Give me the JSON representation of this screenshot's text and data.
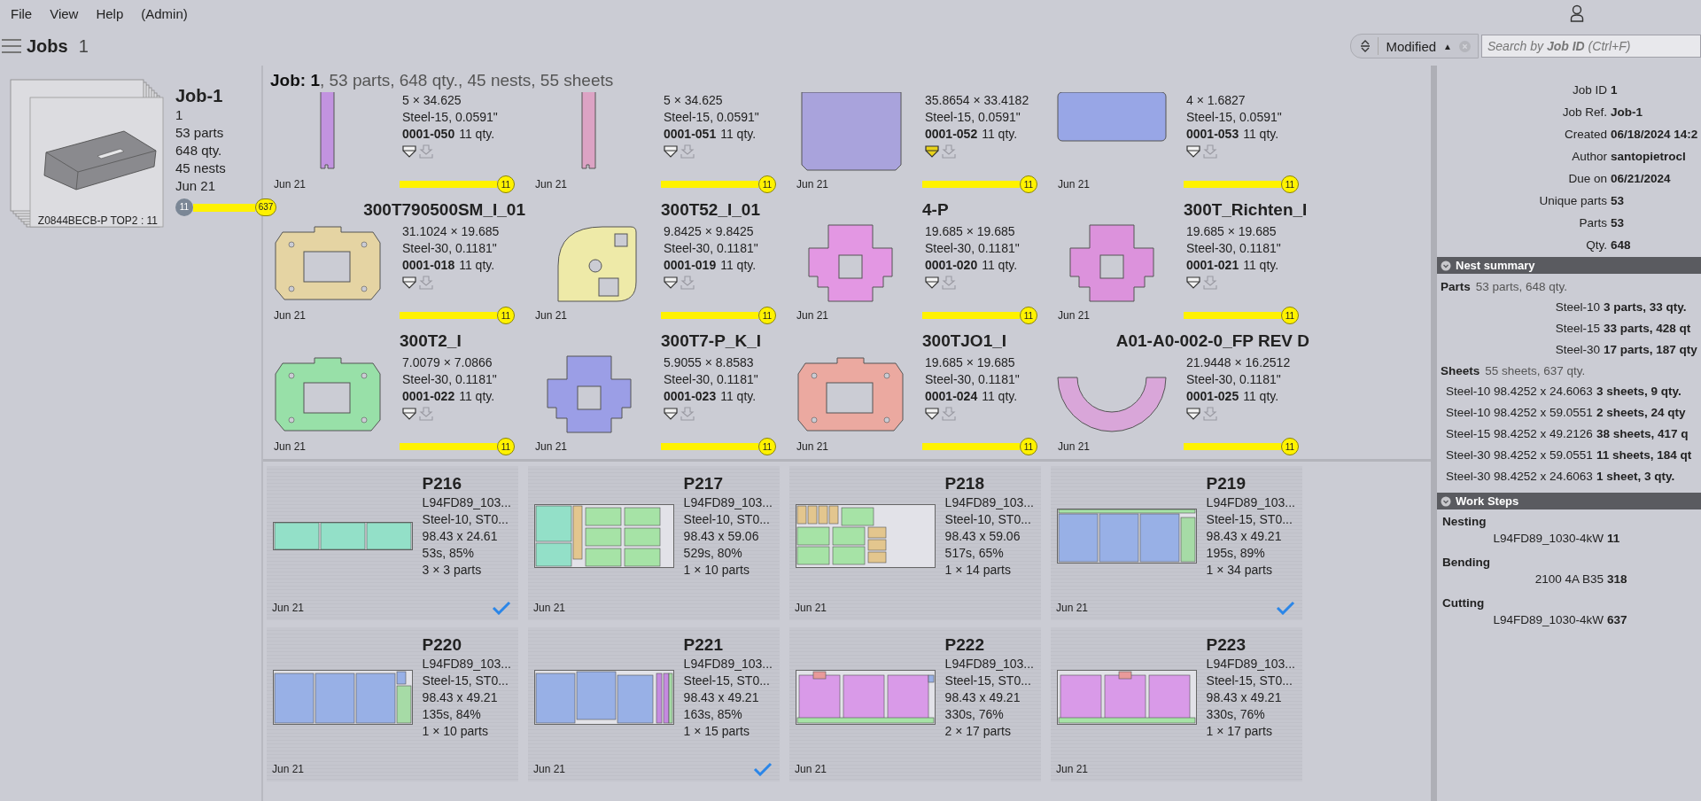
{
  "menu": [
    "File",
    "View",
    "Help"
  ],
  "user_role": "(Admin)",
  "jobs": {
    "title": "Jobs",
    "count": "1"
  },
  "sort": {
    "label": "Modified",
    "direction": "▲"
  },
  "search": {
    "placeholder": "Search by **Job ID** (Ctrl+F)"
  },
  "job": {
    "caption": "Z0844BECB-P TOP2 : 11",
    "name": "Job-1",
    "lines": [
      "1",
      "53 parts",
      "648 qty.",
      "45 nests",
      "Jun 21"
    ],
    "bar_start": "11",
    "bar_end": "637",
    "level": 1
  },
  "job_summary": "**Job: 1**, 53 parts, 648 qty., 45 nests, 55 sheets",
  "parts": [
    {
      "dims": "5 × 34.625",
      "material": "Steel-15, 0.0591\"",
      "id": "0001-050",
      "qty": "11 qty.",
      "highlighted": false,
      "date": "Jun 21",
      "reading": "11",
      "level": 1,
      "color": "#c293e0",
      "kind": "strip"
    },
    {
      "dims": "5 × 34.625",
      "material": "Steel-15, 0.0591\"",
      "id": "0001-051",
      "qty": "11 qty.",
      "highlighted": false,
      "date": "Jun 21",
      "reading": "11",
      "level": 1,
      "color": "#dca3c4",
      "kind": "strip"
    },
    {
      "dims": "35.8654 × 33.4182",
      "material": "Steel-15, 0.0591\"",
      "id": "0001-052",
      "qty": "11 qty.",
      "highlighted": true,
      "date": "Jun 21",
      "reading": "11",
      "level": 1,
      "color": "#a9a3dc",
      "kind": "panel"
    },
    {
      "dims": "4 × 1.6827",
      "material": "Steel-15, 0.0591\"",
      "id": "0001-053",
      "qty": "11 qty.",
      "highlighted": false,
      "date": "Jun 21",
      "reading": "11",
      "level": 1,
      "color": "#98a6e6",
      "kind": "bar"
    },
    {
      "name": "300T790500SM_I_01",
      "dims": "31.1024 × 19.685",
      "material": "Steel-30, 0.1181\"",
      "id": "0001-018",
      "qty": "11 qty.",
      "highlighted": false,
      "date": "Jun 21",
      "reading": "11",
      "level": 1,
      "color": "#e5d4a3",
      "kind": "plate"
    },
    {
      "name": "300T52_I_01",
      "dims": "9.8425 × 9.8425",
      "material": "Steel-30, 0.1181\"",
      "id": "0001-019",
      "qty": "11 qty.",
      "highlighted": false,
      "date": "Jun 21",
      "reading": "11",
      "level": 1,
      "color": "#eeeaa8",
      "kind": "disc"
    },
    {
      "name": "4-P",
      "dims": "19.685 × 19.685",
      "material": "Steel-30, 0.1181\"",
      "id": "0001-020",
      "qty": "11 qty.",
      "highlighted": false,
      "date": "Jun 21",
      "reading": "11",
      "level": 1,
      "color": "#e397e3",
      "kind": "cross"
    },
    {
      "name": "300T_Richten_I",
      "dims": "19.685 × 19.685",
      "material": "Steel-30, 0.1181\"",
      "id": "0001-021",
      "qty": "11 qty.",
      "highlighted": false,
      "date": "Jun 21",
      "reading": "11",
      "level": 1,
      "color": "#dc92dc",
      "kind": "cross"
    },
    {
      "name": "300T2_I",
      "dims": "7.0079 × 7.0866",
      "material": "Steel-30, 0.1181\"",
      "id": "0001-022",
      "qty": "11 qty.",
      "highlighted": false,
      "date": "Jun 21",
      "reading": "11",
      "level": 1,
      "color": "#98e0a8",
      "kind": "plate"
    },
    {
      "name": "300T7-P_K_I",
      "dims": "5.9055 × 8.8583",
      "material": "Steel-30, 0.1181\"",
      "id": "0001-023",
      "qty": "11 qty.",
      "highlighted": false,
      "date": "Jun 21",
      "reading": "11",
      "level": 1,
      "color": "#9b9ee6",
      "kind": "cross"
    },
    {
      "name": "300TJO1_I",
      "dims": "19.685 × 19.685",
      "material": "Steel-30, 0.1181\"",
      "id": "0001-024",
      "qty": "11 qty.",
      "highlighted": false,
      "date": "Jun 21",
      "reading": "11",
      "level": 1,
      "color": "#eba9a0",
      "kind": "plate"
    },
    {
      "name": "A01-A0-002-0_FP REV D",
      "dims": "21.9448 × 16.2512",
      "material": "Steel-30, 0.1181\"",
      "id": "0001-025",
      "qty": "11 qty.",
      "highlighted": false,
      "date": "Jun 21",
      "reading": "11",
      "level": 1,
      "color": "#d9a6d9",
      "kind": "ring"
    }
  ],
  "nests": [
    {
      "name": "P216",
      "machine": "L94FD89_103...",
      "material": "Steel-10, ST0...",
      "size": "98.43 x 24.61",
      "time": "53s, 85%",
      "count": "3 × 3 parts",
      "date": "Jun 21",
      "checked": true
    },
    {
      "name": "P217",
      "machine": "L94FD89_103...",
      "material": "Steel-10, ST0...",
      "size": "98.43 x 59.06",
      "time": "529s, 80%",
      "count": "1 × 10 parts",
      "date": "Jun 21",
      "checked": false
    },
    {
      "name": "P218",
      "machine": "L94FD89_103...",
      "material": "Steel-10, ST0...",
      "size": "98.43 x 59.06",
      "time": "517s, 65%",
      "count": "1 × 14 parts",
      "date": "Jun 21",
      "checked": false
    },
    {
      "name": "P219",
      "machine": "L94FD89_103...",
      "material": "Steel-15, ST0...",
      "size": "98.43 x 49.21",
      "time": "195s, 89%",
      "count": "1 × 34 parts",
      "date": "Jun 21",
      "checked": true
    },
    {
      "name": "P220",
      "machine": "L94FD89_103...",
      "material": "Steel-15, ST0...",
      "size": "98.43 x 49.21",
      "time": "135s, 84%",
      "count": "1 × 10 parts",
      "date": "Jun 21",
      "checked": false
    },
    {
      "name": "P221",
      "machine": "L94FD89_103...",
      "material": "Steel-15, ST0...",
      "size": "98.43 x 49.21",
      "time": "163s, 85%",
      "count": "1 × 15 parts",
      "date": "Jun 21",
      "checked": true
    },
    {
      "name": "P222",
      "machine": "L94FD89_103...",
      "material": "Steel-15, ST0...",
      "size": "98.43 x 49.21",
      "time": "330s, 76%",
      "count": "2 × 17 parts",
      "date": "Jun 21",
      "checked": false
    },
    {
      "name": "P223",
      "machine": "L94FD89_103...",
      "material": "Steel-15, ST0...",
      "size": "98.43 x 49.21",
      "time": "330s, 76%",
      "count": "1 × 17 parts",
      "date": "Jun 21",
      "checked": false
    }
  ],
  "details": [
    {
      "label": "Job ID",
      "value": "1"
    },
    {
      "label": "Job Ref.",
      "value": "Job-1"
    },
    {
      "label": "Created",
      "value": "06/18/2024 14:2"
    },
    {
      "label": "Author",
      "value": "santopietrocl"
    },
    {
      "label": "Due on",
      "value": "06/21/2024"
    },
    {
      "label": "Unique parts",
      "value": "53"
    },
    {
      "label": "Parts",
      "value": "53"
    },
    {
      "label": "Qty.",
      "value": "648"
    }
  ],
  "nest_summary": {
    "title": "Nest summary",
    "parts": {
      "label": "Parts",
      "value": "53 parts, 648 qty.",
      "rows": [
        {
          "label": "Steel-10",
          "value": "3 parts, 33 qty."
        },
        {
          "label": "Steel-15",
          "value": "33 parts, 428 qt"
        },
        {
          "label": "Steel-30",
          "value": "17 parts, 187 qty"
        }
      ]
    },
    "sheets": {
      "label": "Sheets",
      "value": "55 sheets, 637 qty.",
      "rows": [
        {
          "label": "Steel-10 98.4252 x 24.6063",
          "value": "3 sheets, 9 qty."
        },
        {
          "label": "Steel-10 98.4252 x 59.0551",
          "value": "2 sheets, 24 qty"
        },
        {
          "label": "Steel-15 98.4252 x 49.2126",
          "value": "38 sheets, 417 q"
        },
        {
          "label": "Steel-30 98.4252 x 59.0551",
          "value": "11 sheets, 184 qt"
        },
        {
          "label": "Steel-30 98.4252 x 24.6063",
          "value": "1 sheet, 3 qty."
        }
      ]
    }
  },
  "work_steps": {
    "title": "Work Steps",
    "steps": [
      {
        "name": "Nesting",
        "machine": "L94FD89_1030-4kW",
        "count": "11"
      },
      {
        "name": "Bending",
        "machine": "2100 4A B35",
        "count": "318"
      },
      {
        "name": "Cutting",
        "machine": "L94FD89_1030-4kW",
        "count": "637"
      }
    ]
  }
}
